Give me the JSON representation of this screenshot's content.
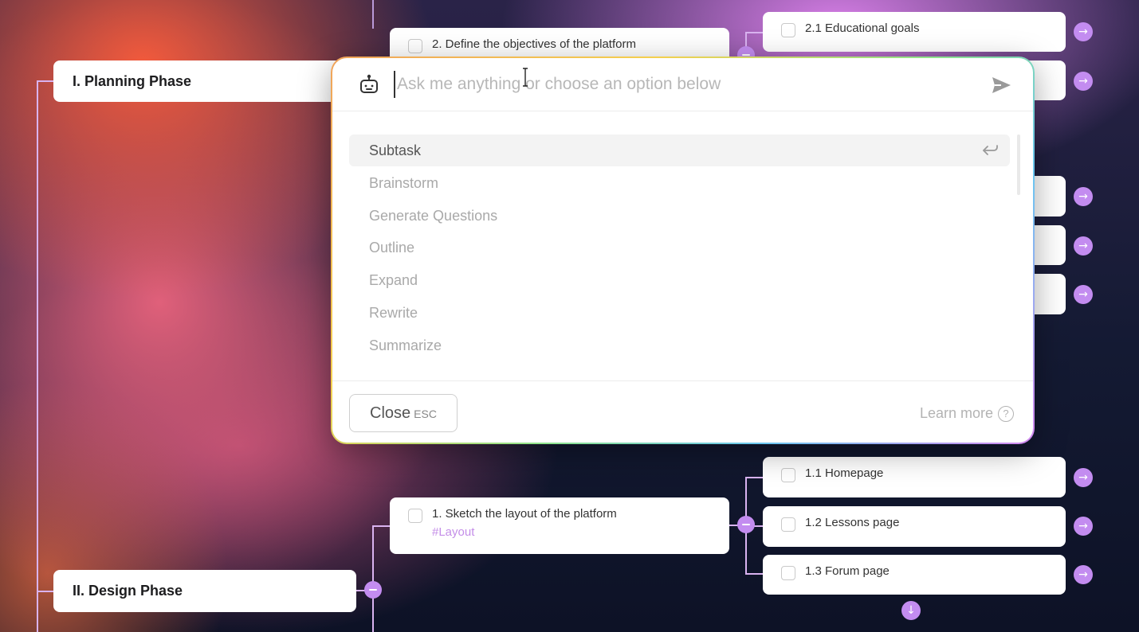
{
  "mindmap": {
    "phases": [
      {
        "label": "I. Planning Phase"
      },
      {
        "label": "II. Design Phase"
      }
    ],
    "planning": {
      "task_define": "2. Define the objectives of the platform",
      "sub_educational_goals": "2.1 Educational goals"
    },
    "design": {
      "task_sketch": "1. Sketch the layout of the platform",
      "task_sketch_tag": "#Layout",
      "subtasks": [
        "1.1 Homepage",
        "1.2 Lessons page",
        "1.3 Forum page"
      ]
    }
  },
  "ai_dialog": {
    "input_placeholder": "Ask me anything or choose an option below",
    "input_value": "",
    "options": [
      "Subtask",
      "Brainstorm",
      "Generate Questions",
      "Outline",
      "Expand",
      "Rewrite",
      "Summarize"
    ],
    "active_option": "Subtask",
    "close_label": "Close",
    "close_shortcut": "ESC",
    "learn_more": "Learn more",
    "help_glyph": "?"
  },
  "icons": {
    "bot": "robot-icon",
    "send": "send-icon",
    "enter": "enter-return-icon",
    "help": "question-circle-icon",
    "expand": "arrow-right-icon",
    "collapse": "minus-icon",
    "more": "arrow-down-icon"
  },
  "colors": {
    "accent": "#c38cf0",
    "tag": "#c48ee8",
    "connector": "#d9b3f0"
  }
}
